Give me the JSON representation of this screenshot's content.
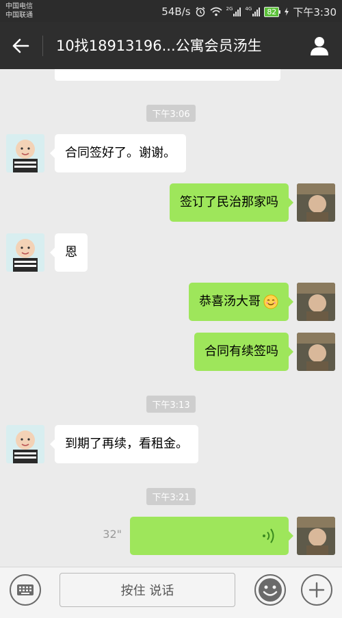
{
  "status_bar": {
    "carrier_1": "中国电信",
    "carrier_2": "中国联通",
    "network_speed": "54B/s",
    "signal_1_type": "2G",
    "signal_2_type": "4G",
    "battery": "82",
    "time": "下午3:30"
  },
  "header": {
    "title": "10找18913196...公寓会员汤生",
    "back_icon": "arrow-left-icon",
    "profile_icon": "person-icon"
  },
  "messages": [
    {
      "type": "time",
      "text": "下午3:06"
    },
    {
      "type": "in",
      "text": "合同签好了。谢谢。"
    },
    {
      "type": "out",
      "text": "签订了民治那家吗"
    },
    {
      "type": "in",
      "text": "恩"
    },
    {
      "type": "out",
      "text": "恭喜汤大哥",
      "emoji": "smiling-face-icon"
    },
    {
      "type": "out",
      "text": "合同有续签吗"
    },
    {
      "type": "time",
      "text": "下午3:13"
    },
    {
      "type": "in",
      "text": "到期了再续，看租金。"
    },
    {
      "type": "time",
      "text": "下午3:21"
    },
    {
      "type": "voice_out",
      "duration": "32\""
    }
  ],
  "input_bar": {
    "hold_to_talk": "按住 说话",
    "keyboard_icon": "keyboard-icon",
    "emoji_icon": "emoji-icon",
    "plus_icon": "plus-icon"
  },
  "colors": {
    "outgoing_bubble": "#9ee65b",
    "incoming_bubble": "#ffffff",
    "header_bg": "#2e2e2e",
    "chat_bg": "#ebebeb"
  }
}
